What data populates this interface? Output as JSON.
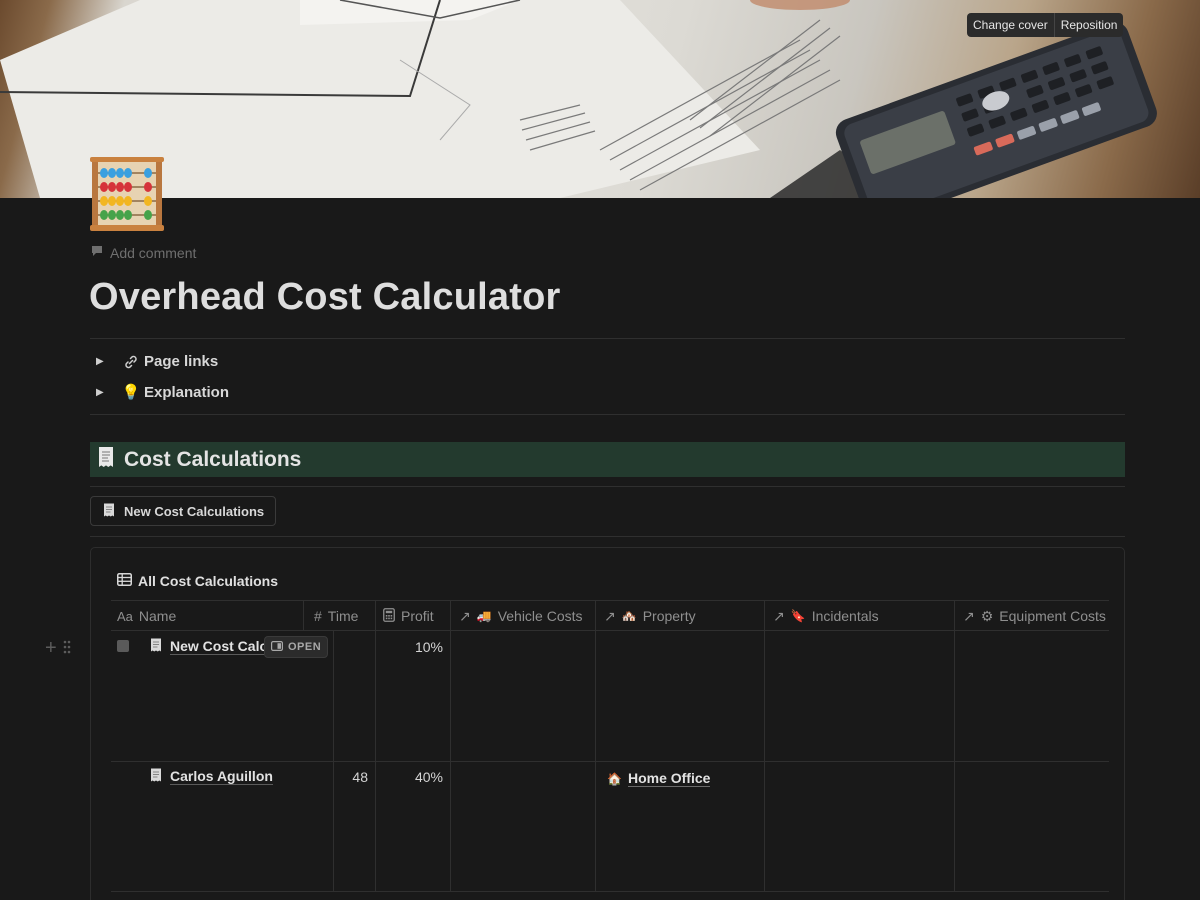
{
  "cover": {
    "change_cover": "Change cover",
    "reposition": "Reposition"
  },
  "page": {
    "add_comment": "Add comment",
    "title": "Overhead Cost Calculator"
  },
  "toggles": [
    {
      "emoji": "🔗",
      "label": "Page links"
    },
    {
      "emoji": "💡",
      "label": "Explanation"
    }
  ],
  "section": {
    "emoji": "🧾",
    "title": "Cost Calculations"
  },
  "new_button": {
    "emoji": "🧾",
    "label": "New Cost Calculations"
  },
  "database": {
    "view_name": "All Cost Calculations",
    "columns": [
      {
        "icon": "Aa",
        "label": "Name"
      },
      {
        "icon": "#",
        "label": "Time"
      },
      {
        "icon": "calculator-icon",
        "label": "Profit"
      },
      {
        "icon": "↗",
        "emoji": "🚚",
        "label": "Vehicle Costs"
      },
      {
        "icon": "↗",
        "emoji": "🏘️",
        "label": "Property"
      },
      {
        "icon": "↗",
        "emoji": "🔖",
        "label": "Incidentals"
      },
      {
        "icon": "↗",
        "emoji": "⚙",
        "label": "Equipment Costs"
      }
    ],
    "open_label": "OPEN",
    "rows": [
      {
        "emoji": "🧾",
        "name": "New Cost Calcu",
        "time": "",
        "profit": "10%",
        "property": ""
      },
      {
        "emoji": "🧾",
        "name": "Carlos Aguillon",
        "time": "48",
        "profit": "40%",
        "property_emoji": "🏠",
        "property": "Home Office"
      }
    ]
  }
}
